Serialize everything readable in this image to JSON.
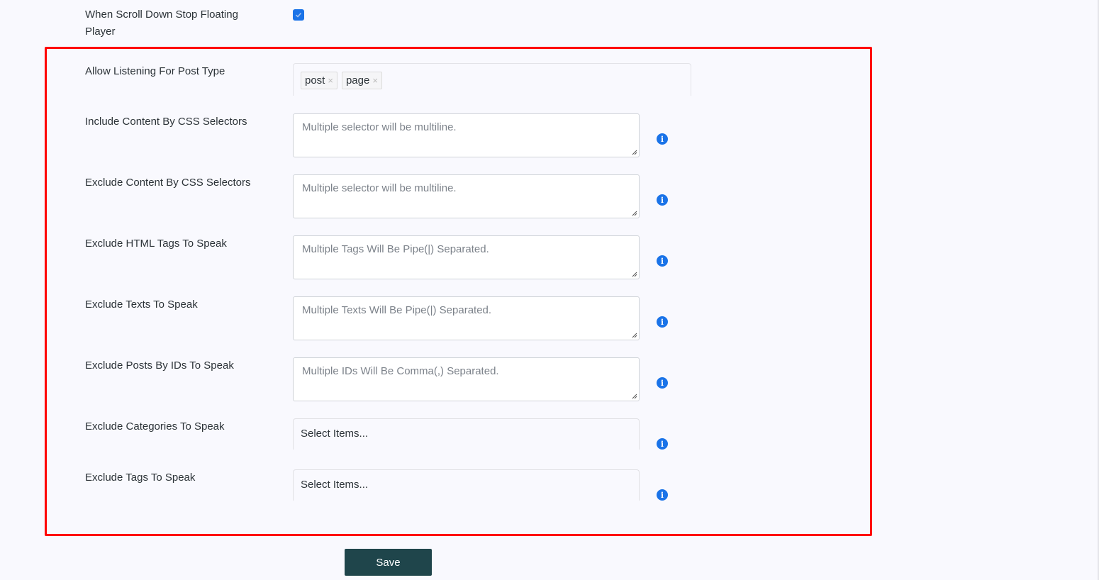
{
  "floating_player": {
    "label": "When Scroll Down Stop Floating Player",
    "checked": true
  },
  "post_type": {
    "label": "Allow Listening For Post Type",
    "tags": [
      "post",
      "page"
    ],
    "remove_glyph": "×"
  },
  "fields": [
    {
      "label": "Include Content By CSS Selectors",
      "placeholder": "Multiple selector will be multiline."
    },
    {
      "label": "Exclude Content By CSS Selectors",
      "placeholder": "Multiple selector will be multiline."
    },
    {
      "label": "Exclude HTML Tags To Speak",
      "placeholder": "Multiple Tags Will Be Pipe(|) Separated."
    },
    {
      "label": "Exclude Texts To Speak",
      "placeholder": "Multiple Texts Will Be Pipe(|) Separated."
    },
    {
      "label": "Exclude Posts By IDs To Speak",
      "placeholder": "Multiple IDs Will Be Comma(,) Separated."
    }
  ],
  "selects": [
    {
      "label": "Exclude Categories To Speak",
      "placeholder": "Select Items..."
    },
    {
      "label": "Exclude Tags To Speak",
      "placeholder": "Select Items..."
    }
  ],
  "info_glyph": "i",
  "save_label": "Save",
  "colors": {
    "accent": "#1a73e8",
    "highlight_border": "#ff0000",
    "save_button": "#1f454b",
    "background": "#f9f9fe"
  }
}
